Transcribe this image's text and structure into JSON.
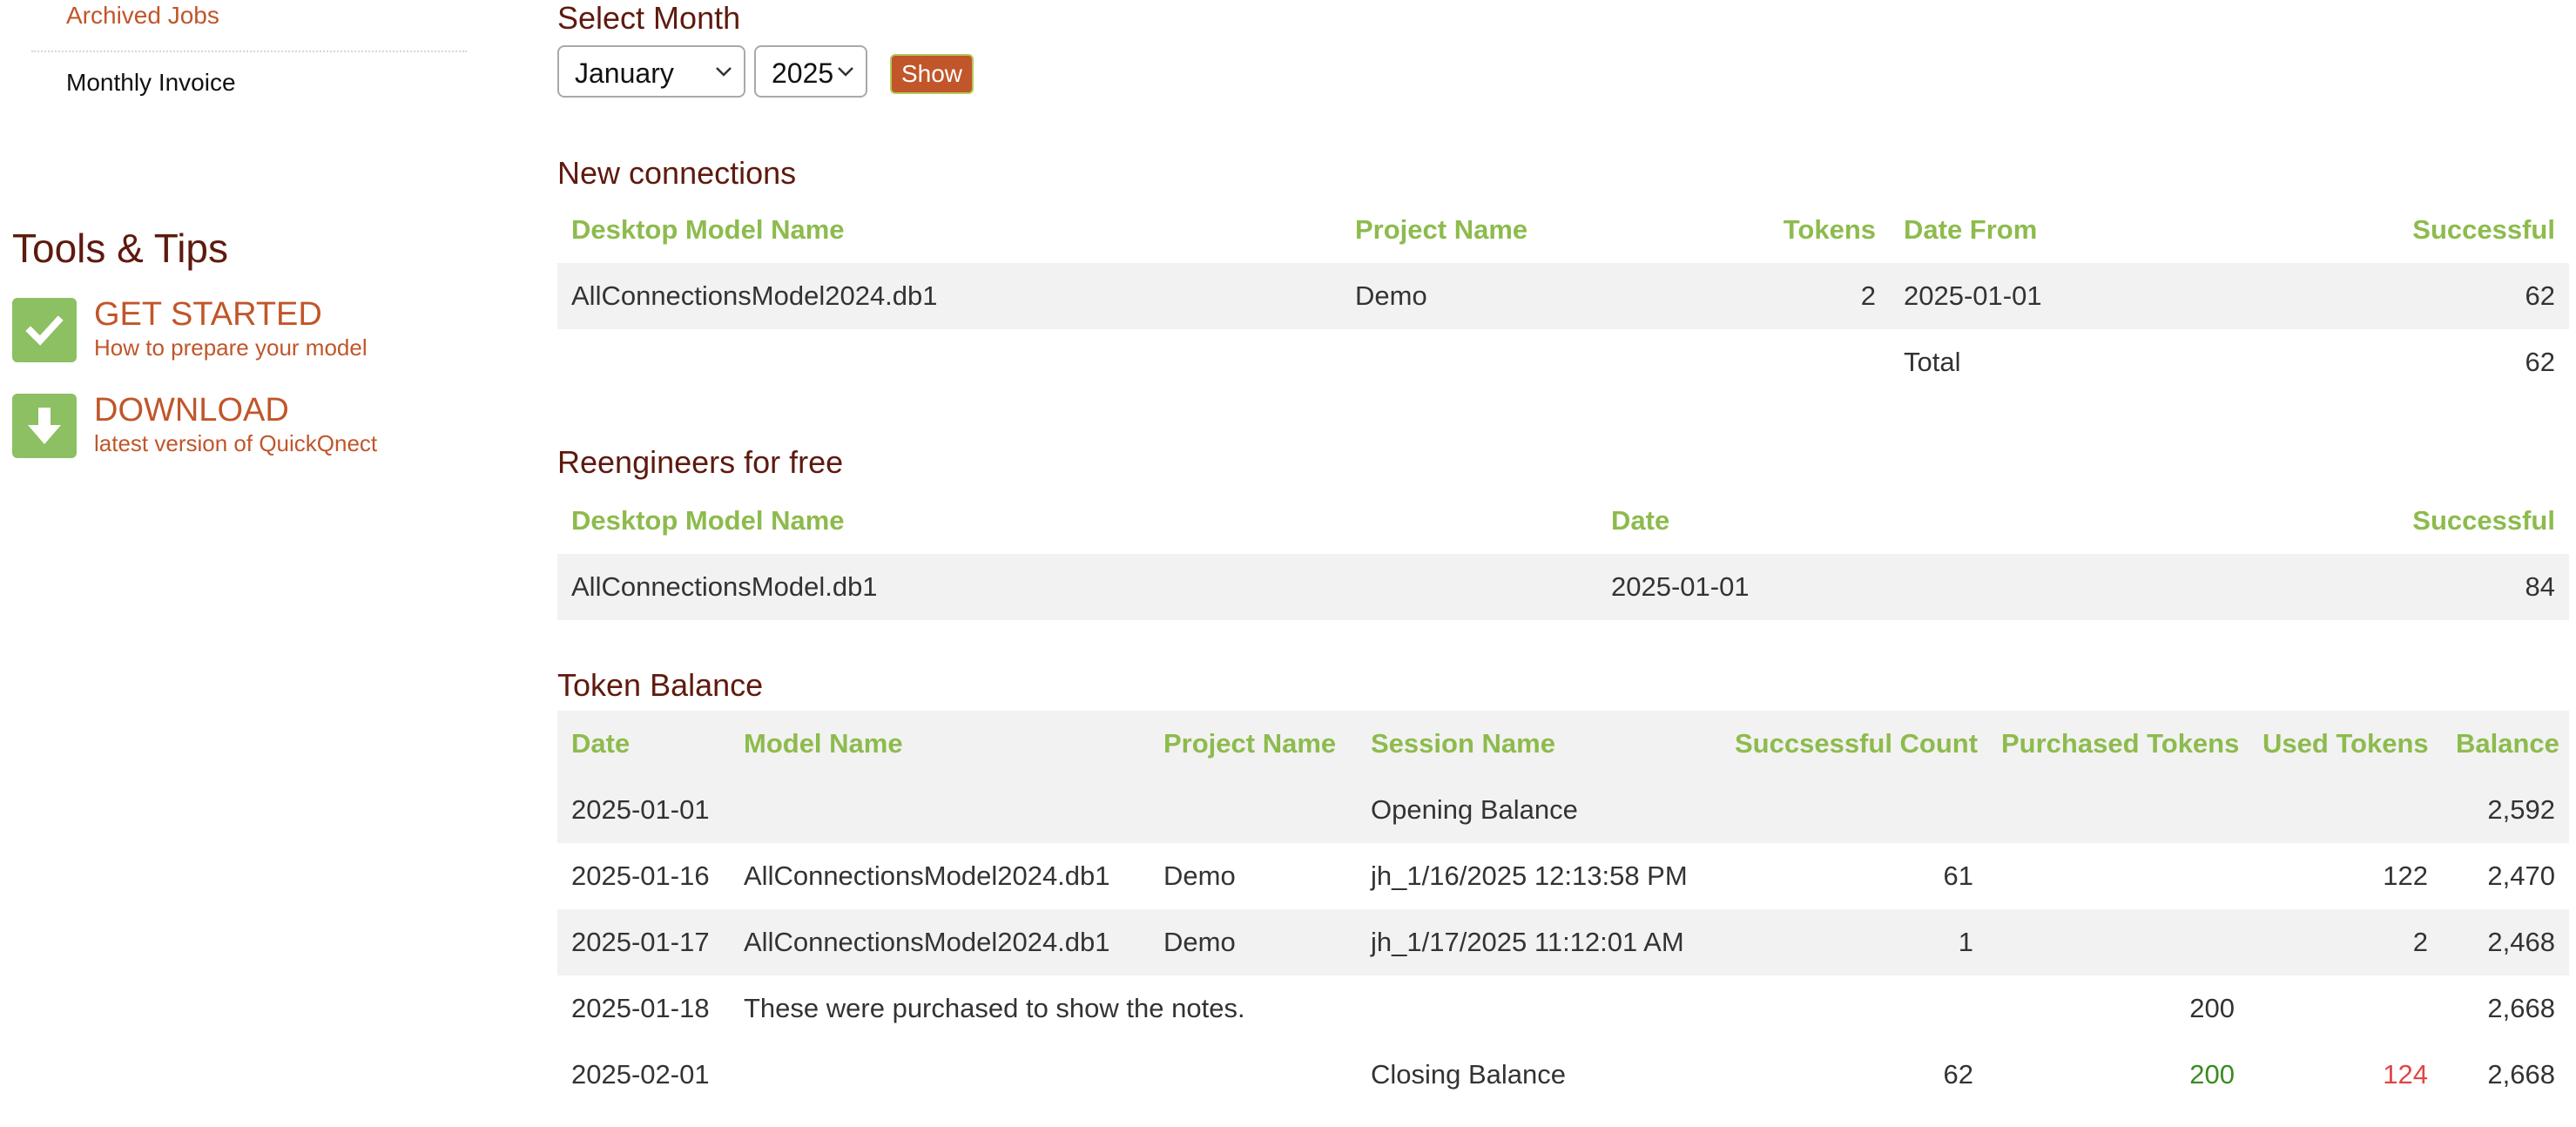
{
  "sidebar": {
    "links": {
      "archived_jobs": "Archived Jobs",
      "monthly_invoice": "Monthly Invoice"
    },
    "tools_title": "Tools & Tips",
    "tips": [
      {
        "title": "GET STARTED",
        "subtitle": "How to prepare your model",
        "icon": "check-icon"
      },
      {
        "title": "DOWNLOAD",
        "subtitle": "latest version of QuickQnect",
        "icon": "download-arrow-icon"
      }
    ]
  },
  "filter": {
    "title": "Select Month",
    "month_value": "January",
    "year_value": "2025",
    "show_label": "Show"
  },
  "new_connections": {
    "title": "New connections",
    "headers": {
      "model": "Desktop Model Name",
      "project": "Project Name",
      "tokens": "Tokens",
      "date_from": "Date From",
      "successful": "Successful"
    },
    "rows": [
      {
        "model": "AllConnectionsModel2024.db1",
        "project": "Demo",
        "tokens": "2",
        "date_from": "2025-01-01",
        "successful": "62"
      }
    ],
    "total_label": "Total",
    "total_value": "62"
  },
  "reengineers": {
    "title": "Reengineers for free",
    "headers": {
      "model": "Desktop Model Name",
      "date": "Date",
      "successful": "Successful"
    },
    "rows": [
      {
        "model": "AllConnectionsModel.db1",
        "date": "2025-01-01",
        "successful": "84"
      }
    ]
  },
  "token_balance": {
    "title": "Token Balance",
    "headers": {
      "date": "Date",
      "model": "Model Name",
      "project": "Project Name",
      "session": "Session Name",
      "count": "Succsessful Count",
      "purchased": "Purchased Tokens",
      "used": "Used Tokens",
      "balance": "Balance"
    },
    "rows": [
      {
        "date": "2025-01-01",
        "model": "",
        "project": "",
        "session": "Opening Balance",
        "count": "",
        "purchased": "",
        "used": "",
        "balance": "2,592"
      },
      {
        "date": "2025-01-16",
        "model": "AllConnectionsModel2024.db1",
        "project": "Demo",
        "session": "jh_1/16/2025 12:13:58 PM",
        "count": "61",
        "purchased": "",
        "used": "122",
        "balance": "2,470"
      },
      {
        "date": "2025-01-17",
        "model": "AllConnectionsModel2024.db1",
        "project": "Demo",
        "session": "jh_1/17/2025 11:12:01 AM",
        "count": "1",
        "purchased": "",
        "used": "2",
        "balance": "2,468"
      },
      {
        "date": "2025-01-18",
        "note": "These were purchased to show the notes.",
        "purchased": "200",
        "used": "",
        "balance": "2,668"
      }
    ],
    "closing": {
      "date": "2025-02-01",
      "session": "Closing Balance",
      "count": "62",
      "purchased": "200",
      "used": "124",
      "balance": "2,668"
    },
    "colors": {
      "purchased": "#3c8a22",
      "used": "#e04545",
      "header": "#8dbb4d",
      "title": "#5e1a0e",
      "link": "#c0562a"
    }
  }
}
